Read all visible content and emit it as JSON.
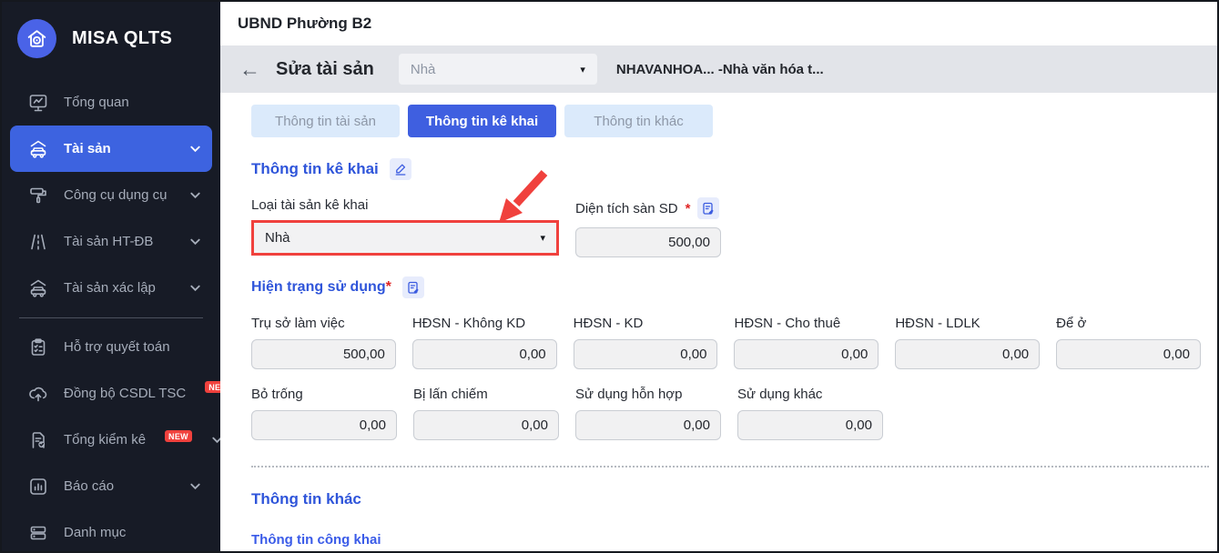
{
  "colors": {
    "sidebar_bg": "#171b26",
    "active_item_blue": "#3d63e0",
    "tab_active_blue": "#3f5fe0",
    "tab_inactive_bg": "#dbeafb",
    "heading_blue": "#2f55da",
    "badge_red": "#f0413d",
    "annotation_red": "#f0413d",
    "greybar_bg": "#e2e4e9",
    "input_bg": "#f1f1f2"
  },
  "icons": {
    "back": "←",
    "caret_down": "▾"
  },
  "brand": {
    "name": "MISA QLTS"
  },
  "topbar": {
    "org_name": "UBND Phường B2"
  },
  "sidebar": {
    "items": [
      {
        "label": "Tổng quan",
        "icon": "monitor-chart"
      },
      {
        "label": "Tài sản",
        "icon": "house-car",
        "active": true
      },
      {
        "label": "Công cụ dụng cụ",
        "icon": "paint-roller"
      },
      {
        "label": "Tài sản HT-ĐB",
        "icon": "road"
      },
      {
        "label": "Tài sản xác lập",
        "icon": "house-car"
      },
      {
        "label": "Hỗ trợ quyết toán",
        "icon": "clipboard-check"
      },
      {
        "label": "Đồng bộ CSDL TSC",
        "icon": "cloud-upload",
        "badge": "NEW"
      },
      {
        "label": "Tổng kiểm kê",
        "icon": "document-check",
        "badge": "NEW"
      },
      {
        "label": "Báo cáo",
        "icon": "bar-chart"
      },
      {
        "label": "Danh mục",
        "icon": "server-list"
      }
    ]
  },
  "header": {
    "title": "Sửa tài sản",
    "type_dropdown_value": "Nhà",
    "asset_name": "NHAVANHOA... -Nhà văn hóa t..."
  },
  "tabs": {
    "items": [
      {
        "label": "Thông tin tài sản",
        "active": false
      },
      {
        "label": "Thông tin kê khai",
        "active": true
      },
      {
        "label": "Thông tin khác",
        "active": false
      }
    ]
  },
  "form": {
    "section_title": "Thông tin kê khai",
    "asset_type": {
      "label": "Loại tài sản kê khai",
      "value": "Nhà"
    },
    "floor_area": {
      "label": "Diện tích sàn SD",
      "required": "*",
      "value": "500,00"
    },
    "usage": {
      "title": "Hiện trạng sử dụng",
      "required": "*",
      "row1": [
        {
          "label": "Trụ sở làm việc",
          "value": "500,00"
        },
        {
          "label": "HĐSN - Không KD",
          "value": "0,00"
        },
        {
          "label": "HĐSN - KD",
          "value": "0,00"
        },
        {
          "label": "HĐSN - Cho thuê",
          "value": "0,00"
        },
        {
          "label": "HĐSN - LDLK",
          "value": "0,00"
        },
        {
          "label": "Để ở",
          "value": "0,00"
        }
      ],
      "row2": [
        {
          "label": "Bỏ trống",
          "value": "0,00"
        },
        {
          "label": "Bị lấn chiếm",
          "value": "0,00"
        },
        {
          "label": "Sử dụng hỗn hợp",
          "value": "0,00"
        },
        {
          "label": "Sử dụng khác",
          "value": "0,00"
        }
      ]
    },
    "other": {
      "title": "Thông tin khác",
      "public_title": "Thông tin công khai"
    }
  }
}
